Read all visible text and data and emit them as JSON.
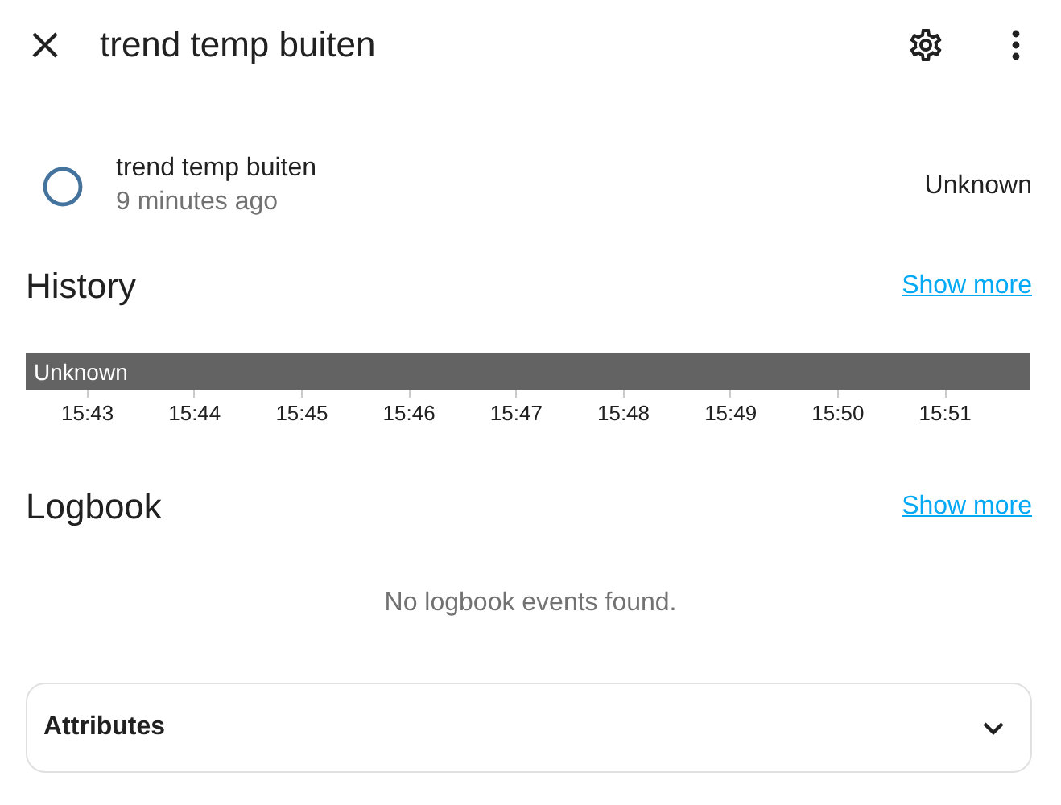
{
  "header": {
    "title": "trend temp buiten"
  },
  "entity": {
    "name": "trend temp buiten",
    "last_changed": "9 minutes ago",
    "state": "Unknown"
  },
  "history": {
    "title": "History",
    "link": "Show more",
    "segments": [
      {
        "label": "Unknown",
        "color": "#636363"
      }
    ],
    "ticks": [
      "15:43",
      "15:44",
      "15:45",
      "15:46",
      "15:47",
      "15:48",
      "15:49",
      "15:50",
      "15:51"
    ]
  },
  "logbook": {
    "title": "Logbook",
    "link": "Show more",
    "empty": "No logbook events found."
  },
  "attributes": {
    "title": "Attributes",
    "expanded": false
  }
}
